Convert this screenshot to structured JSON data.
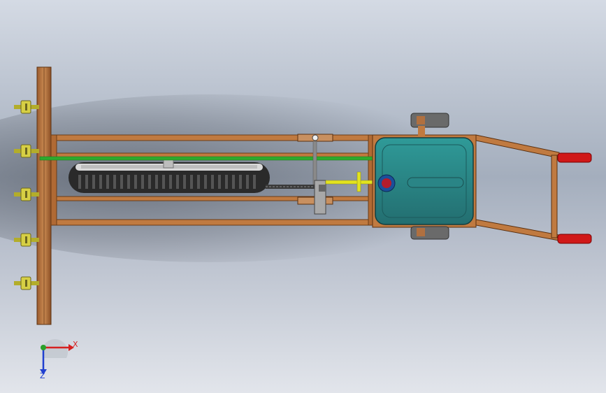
{
  "viewport": {
    "background_top": "#cfd6e2",
    "background_mid": "#a9b2c2",
    "background_bottom": "#dfe3ea"
  },
  "colors": {
    "frame": "#b8733e",
    "frame_dark": "#7a4a24",
    "tank_fill": "#2d8a8a",
    "tank_edge": "#1f5f62",
    "green_pipe": "#2eaa2e",
    "yellow_shaft": "#e3e31f",
    "handle_grip": "#d01818",
    "nozzle": "#c8c23a",
    "chain": "#3a3a3a",
    "tire": "#2a2a2a",
    "axis_x": "#d62020",
    "axis_y": "#2aa02a",
    "axis_z": "#2040d0"
  },
  "triad": {
    "x_label": "X",
    "z_label": "Z"
  },
  "parts": {
    "nozzles": [
      "nozzle-1",
      "nozzle-2",
      "nozzle-3",
      "nozzle-4",
      "nozzle-5"
    ],
    "icons": [
      "coordinate-triad-icon"
    ]
  }
}
